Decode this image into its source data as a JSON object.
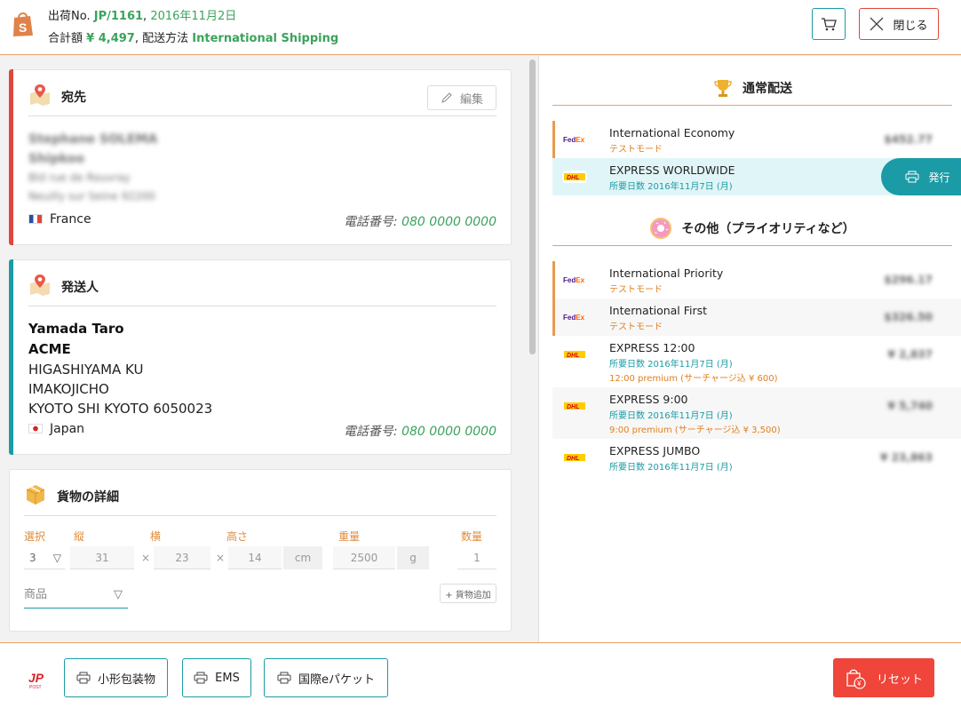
{
  "header": {
    "shipment_label": "出荷No.",
    "shipment_no": "JP/1161",
    "separator": ",",
    "date": "2016年11月2日",
    "total_label": "合計額",
    "total": "¥ 4,497",
    "method_label": "配送方法",
    "method": "International Shipping",
    "close_label": "閉じる"
  },
  "destination": {
    "title": "宛先",
    "edit_label": "編集",
    "name": "Stephane SOLEMA",
    "company": "Shipkoo",
    "street": "Bld rue de Rouvray",
    "city": "Neuilly sur Seine 92200",
    "country": "France",
    "phone_label": "電話番号:",
    "phone": "080 0000 0000"
  },
  "sender": {
    "title": "発送人",
    "name": "Yamada Taro",
    "company": "ACME",
    "line1": "HIGASHIYAMA KU",
    "line2": "IMAKOJICHO",
    "line3": "KYOTO SHI KYOTO 6050023",
    "country": "Japan",
    "phone_label": "電話番号:",
    "phone": "080 0000 0000"
  },
  "cargo": {
    "title": "貨物の詳細",
    "labels": {
      "select": "選択",
      "length": "縦",
      "width": "横",
      "height": "高さ",
      "weight": "重量",
      "qty": "数量"
    },
    "values": {
      "select": "3",
      "length": "31",
      "width": "23",
      "height": "14",
      "weight": "2500",
      "qty": "1"
    },
    "times": "×",
    "unit_cm": "cm",
    "unit_g": "g",
    "goods_placeholder": "商品",
    "select_arrow": "▽",
    "add_label": "+ 貨物追加"
  },
  "standard": {
    "title": "通常配送",
    "services": [
      {
        "carrier": "FedEx",
        "name": "International Economy",
        "sub": "テストモード",
        "price": "$452.77"
      },
      {
        "carrier": "DHL",
        "name": "EXPRESS WORLDWIDE",
        "sub": "所要日数 2016年11月7日 (月)",
        "issue_label": "発行"
      }
    ]
  },
  "other": {
    "title": "その他（プライオリティなど）",
    "services": [
      {
        "carrier": "FedEx",
        "name": "International Priority",
        "sub": "テストモード",
        "price": "$296.17"
      },
      {
        "carrier": "FedEx",
        "name": "International First",
        "sub": "テストモード",
        "price": "$326.50"
      },
      {
        "carrier": "DHL",
        "name": "EXPRESS 12:00",
        "sub": "所要日数 2016年11月7日 (月)",
        "sub2": "12:00 premium (サーチャージ込 ¥ 600)",
        "price": "¥ 2,837"
      },
      {
        "carrier": "DHL",
        "name": "EXPRESS 9:00",
        "sub": "所要日数 2016年11月7日 (月)",
        "sub2": "9:00 premium (サーチャージ込 ¥ 3,500)",
        "price": "¥ 5,740"
      },
      {
        "carrier": "DHL",
        "name": "EXPRESS JUMBO",
        "sub": "所要日数 2016年11月7日 (月)",
        "price": "¥ 23,863"
      }
    ]
  },
  "footer": {
    "btn_small_packet": "小形包装物",
    "btn_ems": "EMS",
    "btn_epacket": "国際eパケット",
    "reset_label": "リセット"
  },
  "colors": {
    "accent_teal": "#1a9ba5",
    "accent_red": "#e0463c",
    "accent_orange": "#e8a06a",
    "green": "#3aa35c"
  }
}
